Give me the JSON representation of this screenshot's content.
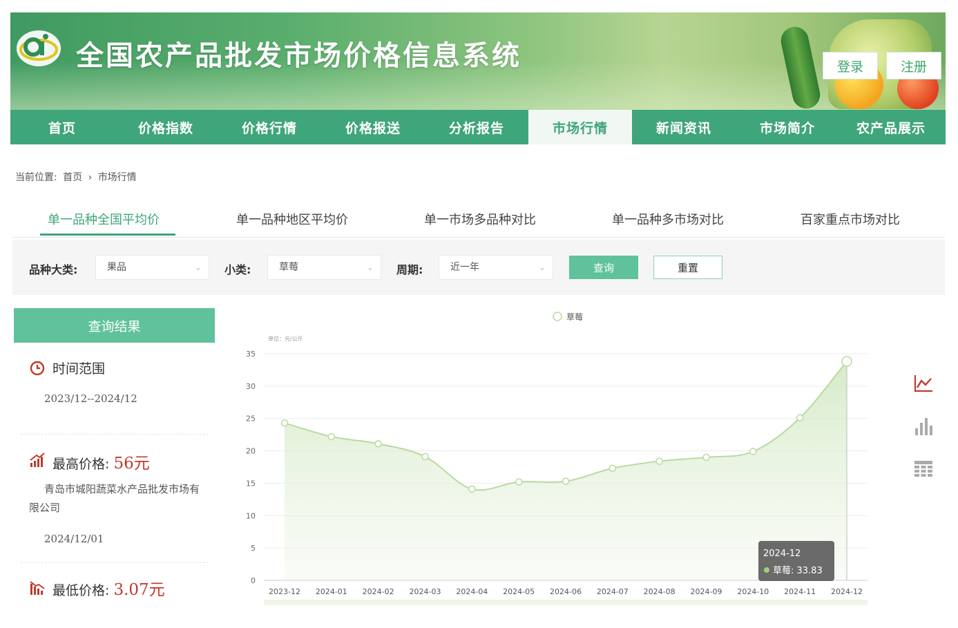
{
  "header": {
    "title": "全国农产品批发市场价格信息系统",
    "login_label": "登录",
    "register_label": "注册"
  },
  "nav": {
    "items": [
      "首页",
      "价格指数",
      "价格行情",
      "价格报送",
      "分析报告",
      "市场行情",
      "新闻资讯",
      "市场简介",
      "农产品展示"
    ],
    "active_index": 5
  },
  "breadcrumb": {
    "label": "当前位置:",
    "home": "首页",
    "separator": "›",
    "current": "市场行情"
  },
  "subtabs": {
    "items": [
      "单一品种全国平均价",
      "单一品种地区平均价",
      "单一市场多品种对比",
      "单一品种多市场对比",
      "百家重点市场对比"
    ],
    "active_index": 0
  },
  "filters": {
    "category_label": "品种大类:",
    "category_value": "果品",
    "subcategory_label": "小类:",
    "subcategory_value": "草莓",
    "period_label": "周期:",
    "period_value": "近一年",
    "query_label": "查询",
    "reset_label": "重置"
  },
  "results": {
    "header": "查询结果",
    "time_range_label": "时间范围",
    "time_range_value": "2023/12--2024/12",
    "max_label": "最高价格:",
    "max_value": "56元",
    "max_market": "青岛市城阳蔬菜水产品批发市场有限公司",
    "max_date": "2024/12/01",
    "min_label": "最低价格:",
    "min_value": "3.07元"
  },
  "colors": {
    "brand_green": "#3fa57a",
    "accent_green": "#5fc29b",
    "price_red": "#c0392b",
    "line_green": "#b9d9a0"
  },
  "chart_data": {
    "type": "area",
    "title": "",
    "unit_label": "单位：元/公斤",
    "legend": "草莓",
    "x": [
      "2023-12",
      "2024-01",
      "2024-02",
      "2024-03",
      "2024-04",
      "2024-05",
      "2024-06",
      "2024-07",
      "2024-08",
      "2024-09",
      "2024-10",
      "2024-11",
      "2024-12"
    ],
    "series": [
      {
        "name": "草莓",
        "values": [
          24.3,
          22.2,
          21.1,
          19.1,
          14.1,
          15.2,
          15.3,
          17.3,
          18.4,
          19.0,
          19.9,
          25.1,
          33.83
        ]
      }
    ],
    "ylim": [
      0,
      35
    ],
    "yticks": [
      0,
      5,
      10,
      15,
      20,
      25,
      30,
      35
    ],
    "grid": true,
    "tooltip": {
      "title": "2024-12",
      "label": "草莓: 33.83"
    }
  },
  "tools": {
    "icons": [
      "line-chart-icon",
      "bar-chart-icon",
      "data-table-icon"
    ]
  }
}
